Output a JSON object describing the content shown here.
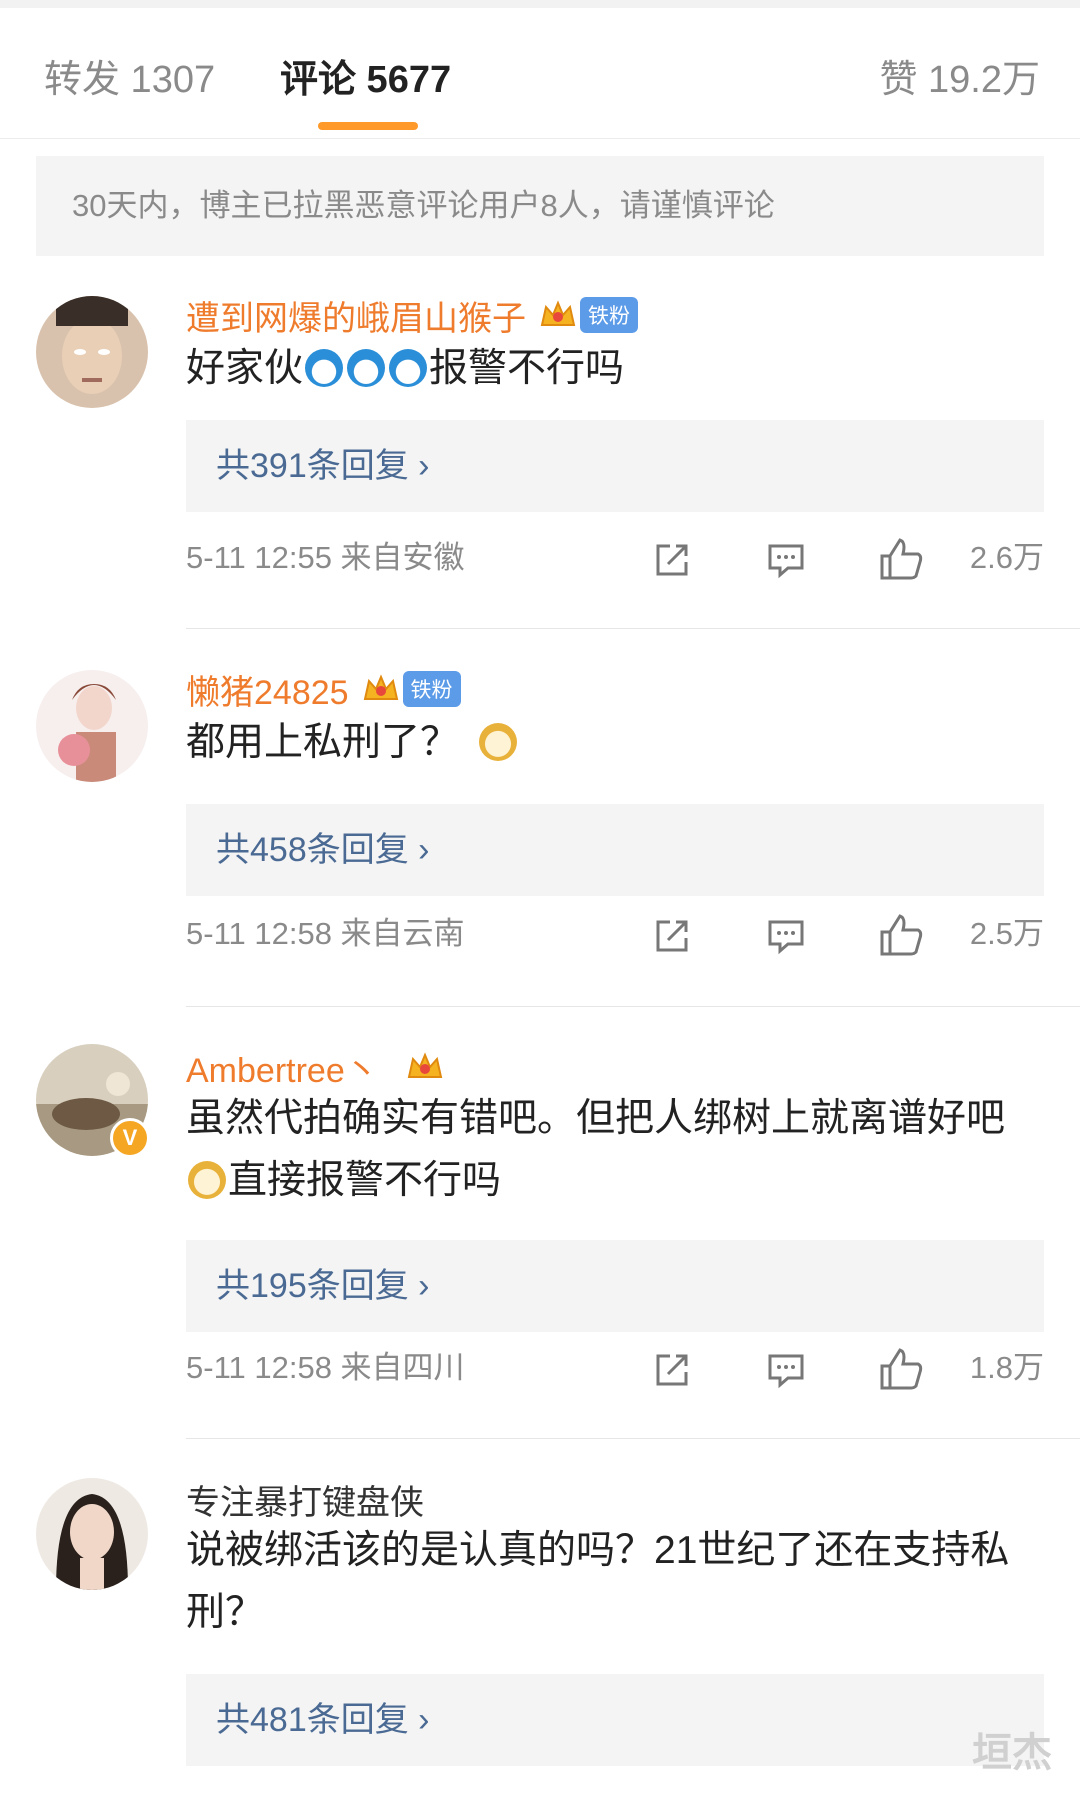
{
  "tabs": {
    "forward": "转发 1307",
    "comments": "评论 5677",
    "likes": "赞 19.2万",
    "active_color": "#ff9a2a"
  },
  "notice": "30天内，博主已拉黑恶意评论用户8人，请谨慎评论",
  "comments": [
    {
      "username": "遭到网爆的峨眉山猴子",
      "badge": "铁粉",
      "content_parts": [
        "好家伙",
        "报警不行吗"
      ],
      "replies": "共391条回复 ›",
      "time": "5-11 12:55 来自安徽",
      "likes": "2.6万"
    },
    {
      "username": "懒猪24825",
      "badge": "铁粉",
      "content_parts": [
        "都用上私刑了？"
      ],
      "replies": "共458条回复 ›",
      "time": "5-11 12:58 来自云南",
      "likes": "2.5万"
    },
    {
      "username": "Ambertree丶",
      "content_parts": [
        "虽然代拍确实有错吧。但把人绑树上就离谱好吧",
        "直接报警不行吗"
      ],
      "replies": "共195条回复 ›",
      "time": "5-11 12:58 来自四川",
      "likes": "1.8万"
    },
    {
      "username": "专注暴打键盘侠",
      "content_parts": [
        "说被绑活该的是认真的吗？21世纪了还在支持私刑？"
      ],
      "replies": "共481条回复 ›"
    }
  ],
  "icons": [
    "share-icon",
    "comment-icon",
    "thumbs-up-icon",
    "crown-icon",
    "verified-icon"
  ],
  "watermark": "垣杰",
  "colors": {
    "username": "#ef7b2c",
    "reply_link": "#4a6a94",
    "fan_badge": "#5b9be8"
  }
}
